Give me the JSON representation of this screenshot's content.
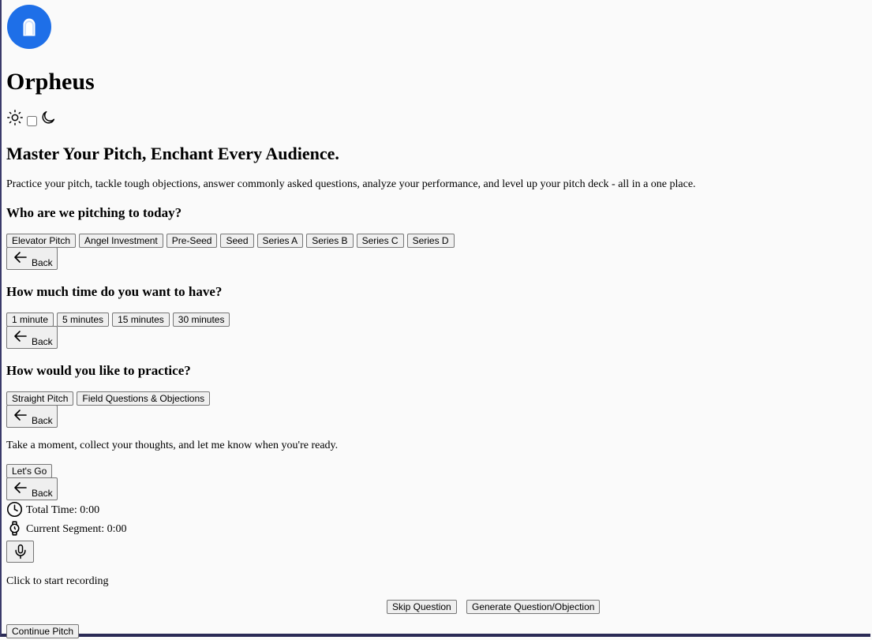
{
  "app": {
    "title": "Orpheus",
    "logo_icon": "orpheus-logo-icon",
    "brand_color": "#1e6fe8"
  },
  "theme": {
    "light_icon": "sun-icon",
    "dark_icon": "moon-icon",
    "dark_mode": false
  },
  "hero": {
    "headline": "Master Your Pitch, Enchant Every Audience.",
    "description": "Practice your pitch, tackle tough objections, answer commonly asked questions, analyze your performance, and level up your pitch deck - all in a one place."
  },
  "audience": {
    "question": "Who are we pitching to today?",
    "options": [
      "Elevator Pitch",
      "Angel Investment",
      "Pre-Seed",
      "Seed",
      "Series A",
      "Series B",
      "Series C",
      "Series D"
    ],
    "back_label": "Back"
  },
  "duration": {
    "question": "How much time do you want to have?",
    "options": [
      "1 minute",
      "5 minutes",
      "15 minutes",
      "30 minutes"
    ],
    "back_label": "Back"
  },
  "mode": {
    "question": "How would you like to practice?",
    "options": [
      "Straight Pitch",
      "Field Questions & Objections"
    ],
    "back_label": "Back"
  },
  "ready": {
    "prompt": "Take a moment, collect your thoughts, and let me know when you're ready.",
    "go_label": "Let's Go",
    "back_label": "Back"
  },
  "session": {
    "total_time": "Total Time: 0:00",
    "current_segment": "Current Segment: 0:00",
    "record_hint": "Click to start recording",
    "skip_label": "Skip Question",
    "generate_label": "Generate Question/Objection",
    "continue_label": "Continue Pitch"
  }
}
